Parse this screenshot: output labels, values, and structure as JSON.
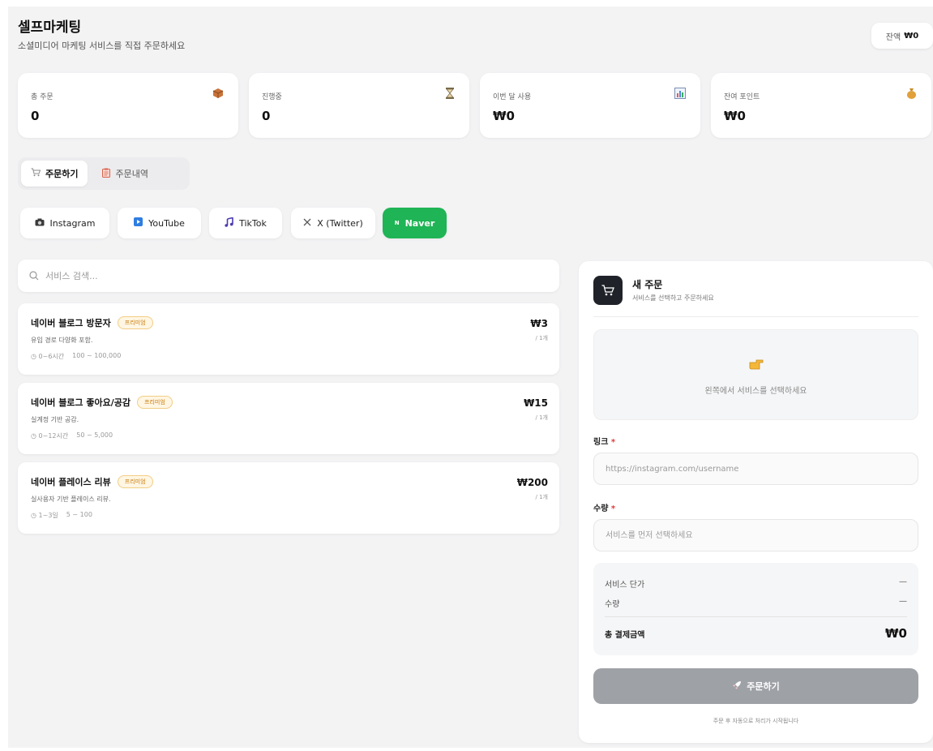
{
  "header": {
    "title": "셀프마케팅",
    "subtitle": "소셜미디어 마케팅 서비스를 직접 주문하세요",
    "balance_label": "잔액",
    "balance_value": "₩0"
  },
  "stats": [
    {
      "label": "총 주문",
      "value": "0",
      "icon": "package-icon"
    },
    {
      "label": "진행중",
      "value": "0",
      "icon": "hourglass-icon"
    },
    {
      "label": "이번 달 사용",
      "value": "₩0",
      "icon": "chart-icon"
    },
    {
      "label": "잔여 포인트",
      "value": "₩0",
      "icon": "money-bag-icon"
    }
  ],
  "main_tabs": [
    {
      "label": "주문하기",
      "icon": "cart-icon",
      "active": true
    },
    {
      "label": "주문내역",
      "icon": "clipboard-icon",
      "active": false
    }
  ],
  "platforms": [
    {
      "label": "Instagram",
      "icon": "camera-icon",
      "active": false
    },
    {
      "label": "YouTube",
      "icon": "play-icon",
      "active": false
    },
    {
      "label": "TikTok",
      "icon": "music-note-icon",
      "active": false
    },
    {
      "label": "X (Twitter)",
      "icon": "x-logo-icon",
      "active": false
    },
    {
      "label": "Naver",
      "icon": "naver-n-icon",
      "active": true,
      "icon_text": "N"
    }
  ],
  "search": {
    "placeholder": "서비스 검색..."
  },
  "services": [
    {
      "name": "네이버 블로그 방문자",
      "badge": "프리미엄",
      "desc": "유입 경로 다양화 포함.",
      "time": "0~6시간",
      "range": "100 ~ 100,000",
      "price": "₩3",
      "unit": "/ 1개"
    },
    {
      "name": "네이버 블로그 좋아요/공감",
      "badge": "프리미엄",
      "desc": "실계정 기반 공감.",
      "time": "0~12시간",
      "range": "50 ~ 5,000",
      "price": "₩15",
      "unit": "/ 1개"
    },
    {
      "name": "네이버 플레이스 리뷰",
      "badge": "프리미엄",
      "desc": "실사용자 기반 플레이스 리뷰.",
      "time": "1~3일",
      "range": "5 ~ 100",
      "price": "₩200",
      "unit": "/ 1개"
    }
  ],
  "order": {
    "title": "새 주문",
    "subtitle": "서비스를 선택하고 주문하세요",
    "empty_message": "왼쪽에서 서비스를 선택하세요",
    "link_label": "링크",
    "link_placeholder": "https://instagram.com/username",
    "qty_label": "수량",
    "qty_placeholder": "서비스를 먼저 선택하세요",
    "required_mark": "*",
    "unit_price_label": "서비스 단가",
    "unit_price_value": "—",
    "qty_row_label": "수량",
    "qty_row_value": "—",
    "total_label": "총 결제금액",
    "total_value": "₩0",
    "button_label": "주문하기",
    "note": "주문 후 자동으로 처리가 시작됩니다"
  },
  "colors": {
    "accent_green": "#1fb455",
    "badge_orange": "#c77a0b",
    "required_red": "#e03a3a",
    "disabled_button": "#9ea1a6"
  }
}
